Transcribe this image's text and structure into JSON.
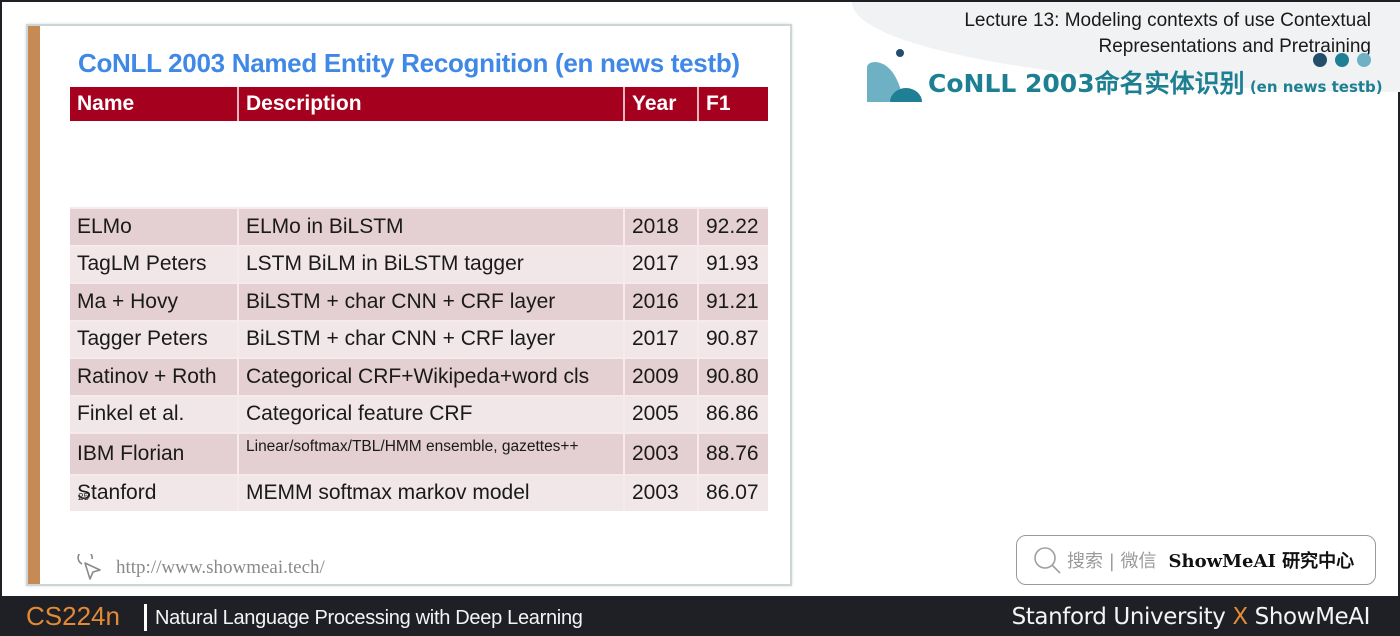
{
  "header": {
    "lecture_title_line1": "Lecture 13:  Modeling contexts of use Contextual",
    "lecture_title_line2": "Representations and Pretraining",
    "section_title_main": "CoNLL 2003命名实体识别",
    "section_title_sub": " (en news testb)",
    "colors": {
      "teal": "#1d7f92",
      "dot1": "#234e6b",
      "dot2": "#1f7f95",
      "dot3": "#6fb1c4"
    }
  },
  "slide": {
    "title": "CoNLL 2003 Named Entity Recognition (en news testb)",
    "slide_number": "25",
    "url": "http://www.showmeai.tech/",
    "table": {
      "headers": [
        "Name",
        "Description",
        "Year",
        "F1"
      ],
      "rows": [
        {
          "name": "ELMo",
          "description": "ELMo in BiLSTM",
          "year": "2018",
          "f1": "92.22"
        },
        {
          "name": "TagLM Peters",
          "description": "LSTM BiLM in BiLSTM tagger",
          "year": "2017",
          "f1": "91.93"
        },
        {
          "name": "Ma + Hovy",
          "description": "BiLSTM + char CNN + CRF layer",
          "year": "2016",
          "f1": "91.21"
        },
        {
          "name": "Tagger Peters",
          "description": "BiLSTM + char CNN + CRF layer",
          "year": "2017",
          "f1": "90.87"
        },
        {
          "name": "Ratinov + Roth",
          "description": "Categorical CRF+Wikipeda+word cls",
          "year": "2009",
          "f1": "90.80"
        },
        {
          "name": "Finkel et al.",
          "description": "Categorical feature CRF",
          "year": "2005",
          "f1": "86.86"
        },
        {
          "name": "IBM Florian",
          "description": "Linear/softmax/TBL/HMM ensemble, gazettes++",
          "year": "2003",
          "f1": "88.76"
        },
        {
          "name": "Stanford",
          "description": "MEMM softmax markov model",
          "year": "2003",
          "f1": "86.07"
        }
      ]
    },
    "colors": {
      "title": "#3f88e6",
      "header_bg": "#a5001e",
      "accent_bar": "#c68a55"
    }
  },
  "search": {
    "hint": "搜索 | 微信",
    "brand": "ShowMeAI 研究中心",
    "icon": "search-icon"
  },
  "footer": {
    "course_code": "CS224n",
    "course_name": "Natural Language Processing with Deep Learning",
    "partner_left": "Stanford University",
    "partner_x": "X",
    "partner_right": "ShowMeAI"
  }
}
